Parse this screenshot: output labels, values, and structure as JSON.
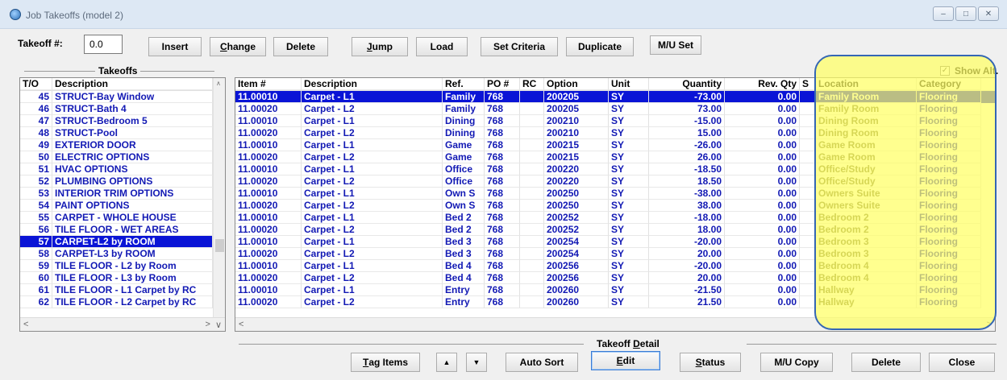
{
  "window": {
    "title": "Job Takeoffs (model 2)",
    "minimize": "–",
    "restore": "□",
    "close": "✕"
  },
  "toolbar": {
    "takeoff_label": "Takeoff #:",
    "takeoff_value": "0.0",
    "insert": "Insert",
    "change_u": "C",
    "change_rest": "hange",
    "delete": "Delete",
    "jump_u": "J",
    "jump_rest": "ump",
    "load": "Load",
    "set_criteria": "Set Criteria",
    "duplicate": "Duplicate",
    "mu_set": "M/U Set"
  },
  "takeoffs": {
    "group_label": "Takeoffs",
    "headers": {
      "to": "T/O",
      "description": "Description"
    },
    "items": [
      {
        "to": "45",
        "description": "STRUCT-Bay Window"
      },
      {
        "to": "46",
        "description": "STRUCT-Bath 4"
      },
      {
        "to": "47",
        "description": "STRUCT-Bedroom 5"
      },
      {
        "to": "48",
        "description": "STRUCT-Pool"
      },
      {
        "to": "49",
        "description": "EXTERIOR DOOR"
      },
      {
        "to": "50",
        "description": "ELECTRIC OPTIONS"
      },
      {
        "to": "51",
        "description": "HVAC OPTIONS"
      },
      {
        "to": "52",
        "description": "PLUMBING OPTIONS"
      },
      {
        "to": "53",
        "description": "INTERIOR TRIM OPTIONS"
      },
      {
        "to": "54",
        "description": "PAINT OPTIONS"
      },
      {
        "to": "55",
        "description": "CARPET - WHOLE HOUSE"
      },
      {
        "to": "56",
        "description": "TILE FLOOR - WET AREAS"
      },
      {
        "to": "57",
        "description": "CARPET-L2 by ROOM"
      },
      {
        "to": "58",
        "description": "CARPET-L3 by ROOM"
      },
      {
        "to": "59",
        "description": "TILE FLOOR - L2 by Room"
      },
      {
        "to": "60",
        "description": "TILE FLOOR - L3 by Room"
      },
      {
        "to": "61",
        "description": "TILE FLOOR - L1 Carpet by RC"
      },
      {
        "to": "62",
        "description": "TILE FLOOR - L2 Carpet by RC"
      }
    ]
  },
  "detail": {
    "show_alt_label": "Show Alt.",
    "headers": {
      "item": "Item #",
      "description": "Description",
      "ref": "Ref.",
      "po": "PO #",
      "rc": "RC",
      "option": "Option",
      "unit": "Unit",
      "quantity": "Quantity",
      "rev_qty": "Rev. Qty",
      "s": "S",
      "location": "Location",
      "category": "Category"
    },
    "rows": [
      {
        "item": "11.00010",
        "description": "Carpet - L1",
        "ref": "Family",
        "po": "768",
        "rc": "",
        "option": "200205",
        "unit": "SY",
        "quantity": "-73.00",
        "rev_qty": "0.00",
        "location": "Family Room",
        "category": "Flooring"
      },
      {
        "item": "11.00020",
        "description": "Carpet - L2",
        "ref": "Family",
        "po": "768",
        "rc": "",
        "option": "200205",
        "unit": "SY",
        "quantity": "73.00",
        "rev_qty": "0.00",
        "location": "Family Room",
        "category": "Flooring"
      },
      {
        "item": "11.00010",
        "description": "Carpet - L1",
        "ref": "Dining",
        "po": "768",
        "rc": "",
        "option": "200210",
        "unit": "SY",
        "quantity": "-15.00",
        "rev_qty": "0.00",
        "location": "Dining Room",
        "category": "Flooring"
      },
      {
        "item": "11.00020",
        "description": "Carpet - L2",
        "ref": "Dining",
        "po": "768",
        "rc": "",
        "option": "200210",
        "unit": "SY",
        "quantity": "15.00",
        "rev_qty": "0.00",
        "location": "Dining Room",
        "category": "Flooring"
      },
      {
        "item": "11.00010",
        "description": "Carpet - L1",
        "ref": "Game",
        "po": "768",
        "rc": "",
        "option": "200215",
        "unit": "SY",
        "quantity": "-26.00",
        "rev_qty": "0.00",
        "location": "Game Room",
        "category": "Flooring"
      },
      {
        "item": "11.00020",
        "description": "Carpet - L2",
        "ref": "Game",
        "po": "768",
        "rc": "",
        "option": "200215",
        "unit": "SY",
        "quantity": "26.00",
        "rev_qty": "0.00",
        "location": "Game Room",
        "category": "Flooring"
      },
      {
        "item": "11.00010",
        "description": "Carpet - L1",
        "ref": "Office",
        "po": "768",
        "rc": "",
        "option": "200220",
        "unit": "SY",
        "quantity": "-18.50",
        "rev_qty": "0.00",
        "location": "Office/Study",
        "category": "Flooring"
      },
      {
        "item": "11.00020",
        "description": "Carpet - L2",
        "ref": "Office",
        "po": "768",
        "rc": "",
        "option": "200220",
        "unit": "SY",
        "quantity": "18.50",
        "rev_qty": "0.00",
        "location": "Office/Study",
        "category": "Flooring"
      },
      {
        "item": "11.00010",
        "description": "Carpet - L1",
        "ref": "Own S",
        "po": "768",
        "rc": "",
        "option": "200250",
        "unit": "SY",
        "quantity": "-38.00",
        "rev_qty": "0.00",
        "location": "Owners Suite",
        "category": "Flooring"
      },
      {
        "item": "11.00020",
        "description": "Carpet - L2",
        "ref": "Own S",
        "po": "768",
        "rc": "",
        "option": "200250",
        "unit": "SY",
        "quantity": "38.00",
        "rev_qty": "0.00",
        "location": "Owners Suite",
        "category": "Flooring"
      },
      {
        "item": "11.00010",
        "description": "Carpet - L1",
        "ref": "Bed 2",
        "po": "768",
        "rc": "",
        "option": "200252",
        "unit": "SY",
        "quantity": "-18.00",
        "rev_qty": "0.00",
        "location": "Bedroom 2",
        "category": "Flooring"
      },
      {
        "item": "11.00020",
        "description": "Carpet - L2",
        "ref": "Bed 2",
        "po": "768",
        "rc": "",
        "option": "200252",
        "unit": "SY",
        "quantity": "18.00",
        "rev_qty": "0.00",
        "location": "Bedroom 2",
        "category": "Flooring"
      },
      {
        "item": "11.00010",
        "description": "Carpet - L1",
        "ref": "Bed 3",
        "po": "768",
        "rc": "",
        "option": "200254",
        "unit": "SY",
        "quantity": "-20.00",
        "rev_qty": "0.00",
        "location": "Bedroom 3",
        "category": "Flooring"
      },
      {
        "item": "11.00020",
        "description": "Carpet - L2",
        "ref": "Bed 3",
        "po": "768",
        "rc": "",
        "option": "200254",
        "unit": "SY",
        "quantity": "20.00",
        "rev_qty": "0.00",
        "location": "Bedroom 3",
        "category": "Flooring"
      },
      {
        "item": "11.00010",
        "description": "Carpet - L1",
        "ref": "Bed 4",
        "po": "768",
        "rc": "",
        "option": "200256",
        "unit": "SY",
        "quantity": "-20.00",
        "rev_qty": "0.00",
        "location": "Bedroom 4",
        "category": "Flooring"
      },
      {
        "item": "11.00020",
        "description": "Carpet - L2",
        "ref": "Bed 4",
        "po": "768",
        "rc": "",
        "option": "200256",
        "unit": "SY",
        "quantity": "20.00",
        "rev_qty": "0.00",
        "location": "Bedroom 4",
        "category": "Flooring"
      },
      {
        "item": "11.00010",
        "description": "Carpet - L1",
        "ref": "Entry",
        "po": "768",
        "rc": "",
        "option": "200260",
        "unit": "SY",
        "quantity": "-21.50",
        "rev_qty": "0.00",
        "location": "Hallway",
        "category": "Flooring"
      },
      {
        "item": "11.00020",
        "description": "Carpet - L2",
        "ref": "Entry",
        "po": "768",
        "rc": "",
        "option": "200260",
        "unit": "SY",
        "quantity": "21.50",
        "rev_qty": "0.00",
        "location": "Hallway",
        "category": "Flooring"
      }
    ]
  },
  "bottom": {
    "group_label_u": "D",
    "group_label_pre": "Takeoff ",
    "group_label_rest": "etail",
    "tag_items_u": "T",
    "tag_items_rest": "ag Items",
    "up_arrow": "▲",
    "down_arrow": "▼",
    "auto_sort": "Auto Sort",
    "edit_u": "E",
    "edit_rest": "dit",
    "status_u": "S",
    "status_rest": "tatus",
    "mu_copy": "M/U Copy",
    "delete": "Delete",
    "close": "Close"
  },
  "colors": {
    "selected_row": "#0a14d6",
    "row_text": "#1219b4",
    "highlight": "#ffff64",
    "highlight_border": "#3466b4"
  }
}
